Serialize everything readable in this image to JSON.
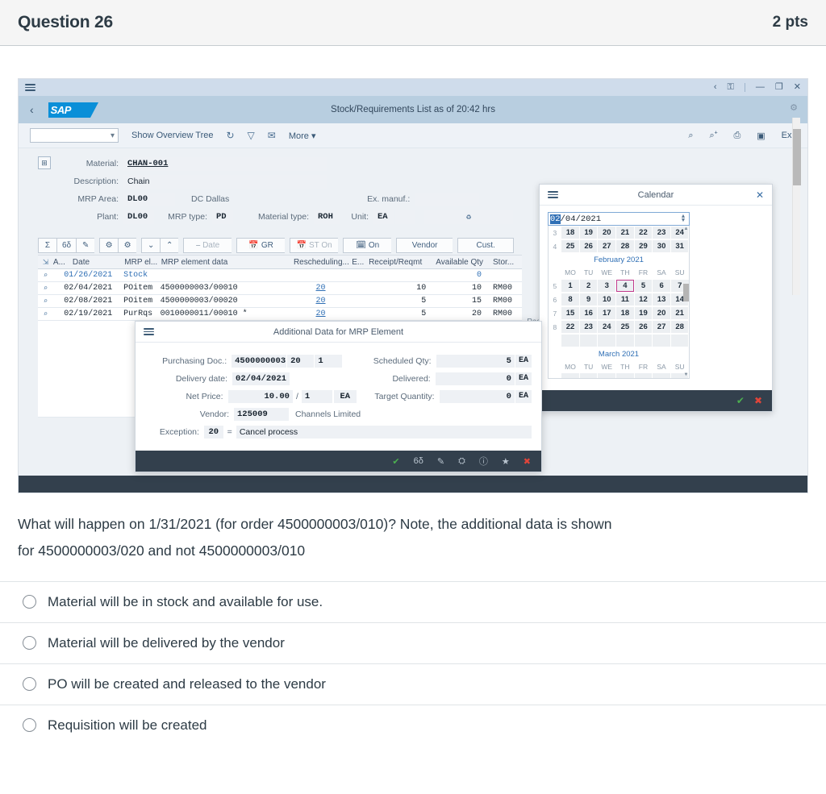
{
  "quiz": {
    "title": "Question 26",
    "points": "2 pts"
  },
  "sap": {
    "shell": {
      "title": "Stock/Requirements List as of 20:42 hrs",
      "logo": "SAP",
      "back_icon": "‹",
      "menu_icon": "hamburger-icon",
      "window_controls": [
        "‹",
        "⛿",
        "—",
        "❐",
        "✕"
      ]
    },
    "action_bar": {
      "selector_value": "",
      "show_overview_tree": "Show Overview Tree",
      "refresh_icon": "↻",
      "filter_icon": "▽",
      "mail_icon": "✉",
      "more": "More",
      "search_icon": "⌕",
      "search_plus_icon": "⌕",
      "print_icon": "⎙",
      "layout_icon": "☷",
      "exit": "Exit"
    },
    "form": {
      "material_label": "Material:",
      "material_value": "CHAN-001",
      "description_label": "Description:",
      "description_value": "Chain",
      "mrp_area_label": "MRP Area:",
      "mrp_area_value": "DL00",
      "mrp_area_text": "DC Dallas",
      "plant_label": "Plant:",
      "plant_value": "DL00",
      "mrp_type_label": "MRP type:",
      "mrp_type_value": "PD",
      "material_type_label": "Material type:",
      "material_type_value": "ROH",
      "unit_label": "Unit:",
      "unit_value": "EA",
      "ex_manuf_label": "Ex. manuf.:",
      "ex_manuf_value": ""
    },
    "table_toolbar": [
      {
        "label": "Σ",
        "disabled": false
      },
      {
        "label": "6δ",
        "disabled": false
      },
      {
        "label": "✎",
        "disabled": false
      },
      {
        "label": "⛭",
        "disabled": false
      },
      {
        "label": "⛬",
        "disabled": false
      },
      {
        "label": "»",
        "disabled": false
      },
      {
        "label": "«",
        "disabled": false
      },
      {
        "label": "Date",
        "disabled": true
      },
      {
        "label": "GR",
        "disabled": false
      },
      {
        "label": "ST On",
        "disabled": true
      },
      {
        "label": "On",
        "disabled": false
      },
      {
        "label": "Vendor",
        "disabled": false
      },
      {
        "label": "Cust.",
        "disabled": false
      }
    ],
    "table": {
      "page_label": "Pag",
      "headers": {
        "a": "A...",
        "date": "Date",
        "mrp_el": "MRP el...",
        "mrp_element_data": "MRP element data",
        "rescheduling": "Rescheduling...",
        "e": "E...",
        "receipt_reqmt": "Receipt/Reqmt",
        "available_qty": "Available Qty",
        "stor": "Stor..."
      },
      "rows": [
        {
          "date": "01/26/2021",
          "mrp_el": "Stock",
          "data": "",
          "resched": "",
          "receipt": "",
          "avail": "0",
          "stor": ""
        },
        {
          "date": "02/04/2021",
          "mrp_el": "POitem",
          "data": "4500000003/00010",
          "resched": "20",
          "receipt": "10",
          "avail": "10",
          "stor": "RM00"
        },
        {
          "date": "02/08/2021",
          "mrp_el": "POitem",
          "data": "4500000003/00020",
          "resched": "20",
          "receipt": "5",
          "avail": "15",
          "stor": "RM00"
        },
        {
          "date": "02/19/2021",
          "mrp_el": "PurRqs",
          "data": "0010000011/00010 *",
          "resched": "20",
          "receipt": "5",
          "avail": "20",
          "stor": "RM00"
        }
      ]
    },
    "calendar": {
      "title": "Calendar",
      "close_icon": "✕",
      "input_prefix": "02",
      "input_rest": "/04/2021",
      "prev_rows": [
        {
          "week": "3",
          "days": [
            "18",
            "19",
            "20",
            "21",
            "22",
            "23",
            "24"
          ]
        },
        {
          "week": "4",
          "days": [
            "25",
            "26",
            "27",
            "28",
            "29",
            "30",
            "31"
          ]
        }
      ],
      "month_february": "February 2021",
      "dow": [
        "MO",
        "TU",
        "WE",
        "TH",
        "FR",
        "SA",
        "SU"
      ],
      "feb_rows": [
        {
          "week": "5",
          "days": [
            "1",
            "2",
            "3",
            "4",
            "5",
            "6",
            "7"
          ]
        },
        {
          "week": "6",
          "days": [
            "8",
            "9",
            "10",
            "11",
            "12",
            "13",
            "14"
          ]
        },
        {
          "week": "7",
          "days": [
            "15",
            "16",
            "17",
            "18",
            "19",
            "20",
            "21"
          ]
        },
        {
          "week": "8",
          "days": [
            "22",
            "23",
            "24",
            "25",
            "26",
            "27",
            "28"
          ]
        }
      ],
      "selected_day": "4",
      "month_march": "March 2021",
      "ok_icon": "✔",
      "cancel_icon": "✖"
    },
    "additional_data": {
      "title": "Additional Data for MRP Element",
      "purchasing_doc_label": "Purchasing Doc.:",
      "purchasing_doc": "4500000003",
      "purchasing_item": "20",
      "purchasing_sched": "1",
      "delivery_date_label": "Delivery date:",
      "delivery_date": "02/04/2021",
      "net_price_label": "Net Price:",
      "net_price": "10.00",
      "net_price_per": "1",
      "net_price_unit": "EA",
      "vendor_label": "Vendor:",
      "vendor_number": "125009",
      "vendor_name": "Channels Limited",
      "exception_label": "Exception:",
      "exception_code": "20",
      "exception_eq": "=",
      "exception_text": "Cancel process",
      "scheduled_qty_label": "Scheduled Qty:",
      "scheduled_qty": "5",
      "scheduled_qty_unit": "EA",
      "delivered_label": "Delivered:",
      "delivered": "0",
      "delivered_unit": "EA",
      "target_quantity_label": "Target Quantity:",
      "target_quantity": "0",
      "target_quantity_unit": "EA",
      "footer_icons": [
        "✔",
        "6δ",
        "✎",
        "⛭",
        "ⓘ",
        "★",
        "✖"
      ]
    }
  },
  "question": {
    "text_line1": "What will happen on 1/31/2021 (for order 4500000003/010)? Note, the additional data is shown",
    "text_line2": "for 4500000003/020 and not 4500000003/010",
    "options": [
      "Material will be in stock and available for use.",
      "Material will be delivered by the vendor",
      "PO will be created and released to the vendor",
      "Requisition will be created"
    ]
  },
  "colors": {
    "shell_bar": "#b8cee0",
    "shell_top": "#cfdceb",
    "sap_blue": "#0a8fd8",
    "footer_dark": "#33404d",
    "link": "#2f6fb5",
    "selected_day_border": "#c0398c"
  }
}
